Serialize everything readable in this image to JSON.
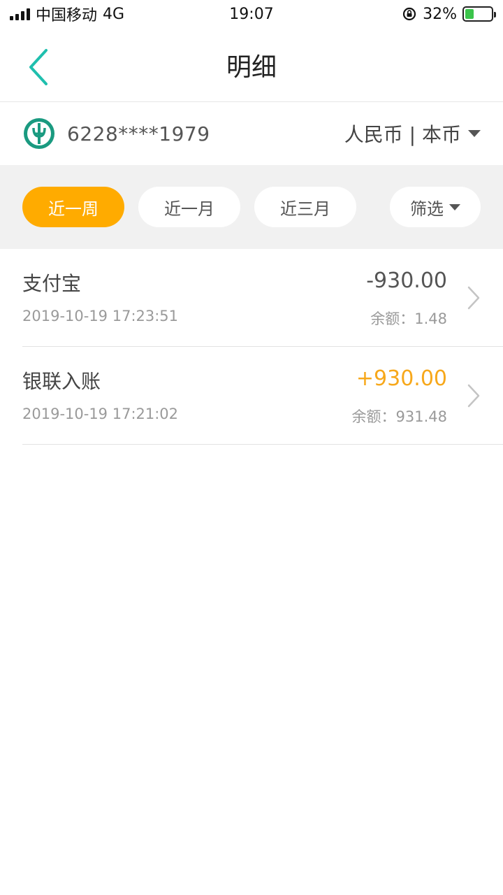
{
  "status_bar": {
    "carrier": "中国移动",
    "network": "4G",
    "time": "19:07",
    "battery_percent": "32%",
    "battery_level": 0.32
  },
  "header": {
    "title": "明细",
    "back_icon": "chevron-left-icon"
  },
  "account": {
    "card_number": "6228****1979",
    "currency_label": "人民币 | 本币",
    "bank_icon": "abc-bank-logo-icon"
  },
  "filters": {
    "periods": [
      "近一周",
      "近一月",
      "近三月"
    ],
    "active_index": 0,
    "filter_label": "筛选"
  },
  "transactions": [
    {
      "name": "支付宝",
      "time": "2019-10-19 17:23:51",
      "amount": "-930.00",
      "balance": "余额：1.48",
      "type": "expense"
    },
    {
      "name": "银联入账",
      "time": "2019-10-19 17:21:02",
      "amount": "+930.00",
      "balance": "余额：931.48",
      "type": "income"
    }
  ],
  "colors": {
    "accent": "#ffab00",
    "income": "#f7a81b",
    "back_arrow": "#1fbfae",
    "bank_logo": "#1a9a80"
  }
}
